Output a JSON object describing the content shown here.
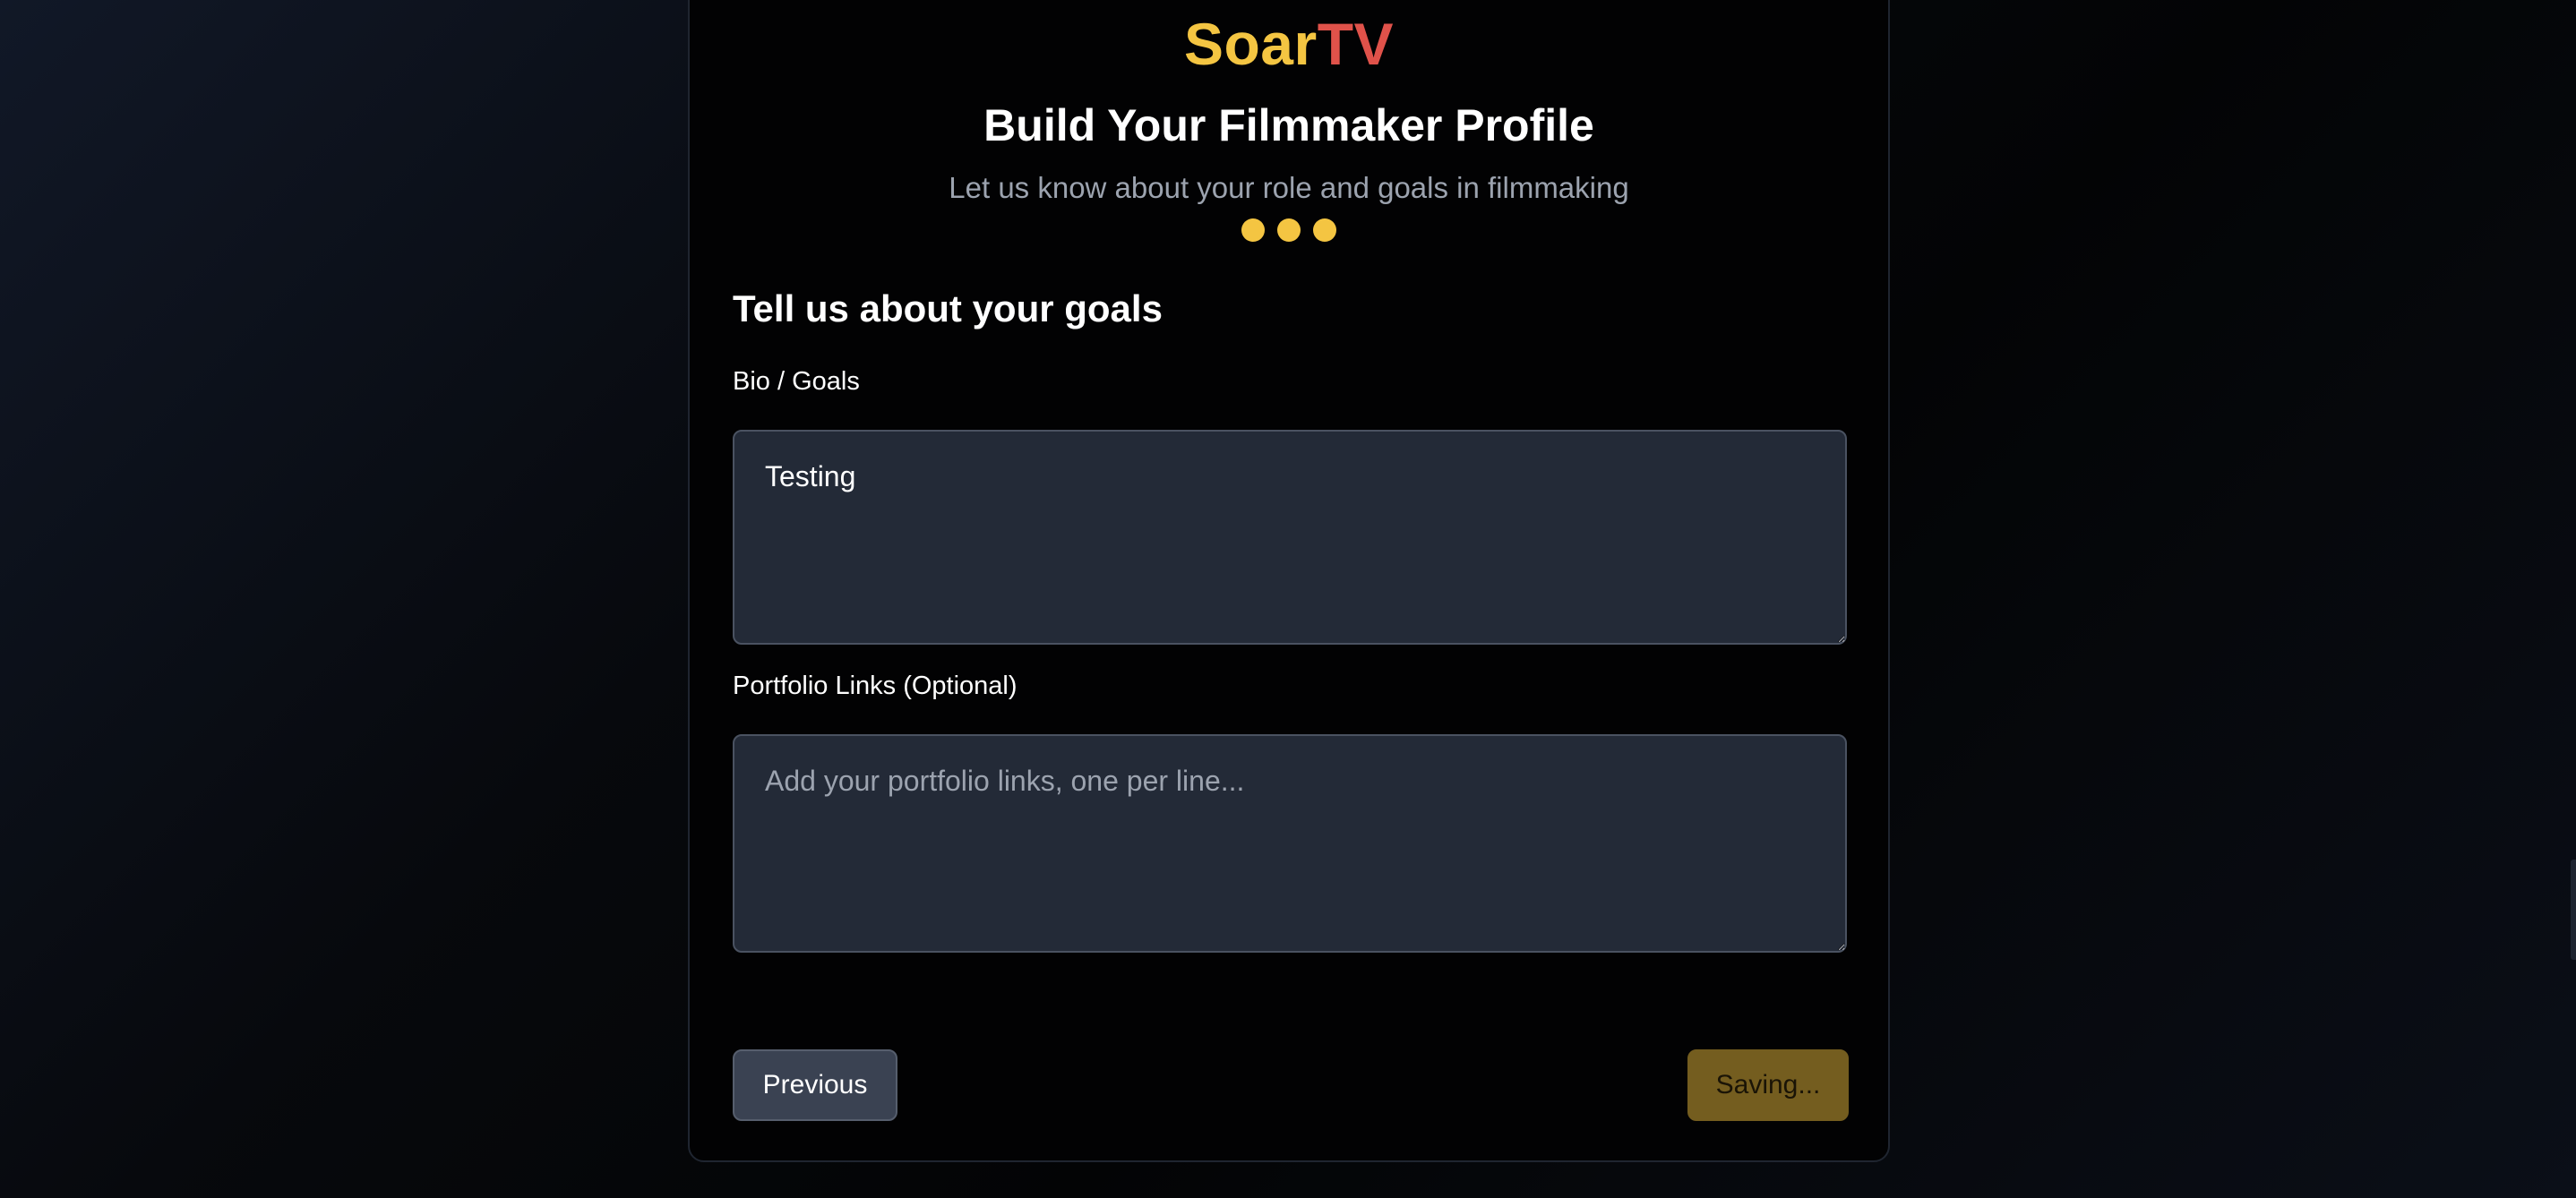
{
  "brand": {
    "part1": "Soar",
    "part2": "TV",
    "color_primary": "#f4c542",
    "color_secondary": "#e0524a"
  },
  "header": {
    "title": "Build Your Filmmaker Profile",
    "subtitle": "Let us know about your role and goals in filmmaking"
  },
  "steps": {
    "total": 3,
    "completed": 3,
    "color": "#f4c542"
  },
  "form": {
    "section_heading": "Tell us about your goals",
    "bio": {
      "label": "Bio / Goals",
      "value": "Testing"
    },
    "portfolio": {
      "label": "Portfolio Links (Optional)",
      "value": "",
      "placeholder": "Add your portfolio links, one per line..."
    }
  },
  "actions": {
    "previous_label": "Previous",
    "save_label": "Saving..."
  }
}
